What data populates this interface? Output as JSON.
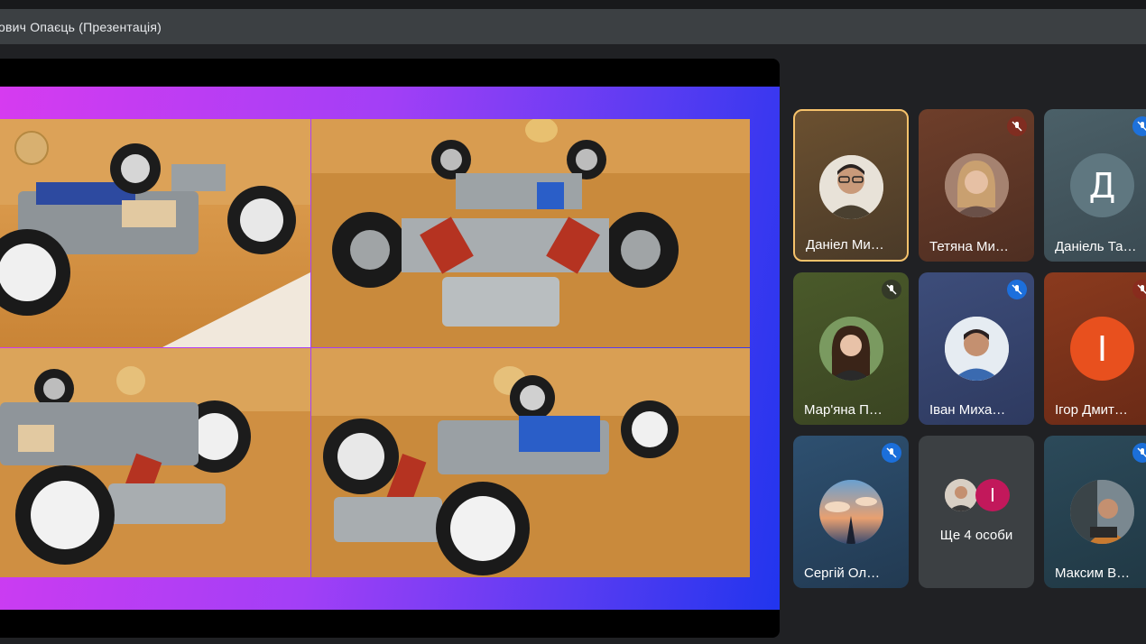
{
  "title": "ович Опаєць (Презентація)",
  "colors": {
    "background": "#202124",
    "titlebar": "#3c4043",
    "speaking_border": "#f6c26b",
    "mic_badge": "#1a73e8"
  },
  "presentation": {
    "slide_images": [
      "car-photo-top-left",
      "car-photo-top-right",
      "car-photo-bottom-left",
      "car-photo-bottom-right"
    ]
  },
  "participants": [
    {
      "name": "Даніел Ми…",
      "avatar": "photo",
      "speaking": true,
      "muted": false
    },
    {
      "name": "Тетяна Ми…",
      "avatar": "photo",
      "speaking": false,
      "muted": true
    },
    {
      "name": "Даніель Та…",
      "avatar_letter": "Д",
      "speaking": false,
      "muted": true
    },
    {
      "name": "Мар'яна П…",
      "avatar": "photo",
      "speaking": false,
      "muted": true
    },
    {
      "name": "Іван Миха…",
      "avatar": "photo",
      "speaking": false,
      "muted": true
    },
    {
      "name": "Ігор Дмит…",
      "avatar_letter": "І",
      "speaking": false,
      "muted": true
    },
    {
      "name": "Сергій Ол…",
      "avatar": "photo",
      "speaking": false,
      "muted": true
    },
    {
      "name": "Ще 4 особи",
      "avatar_letter": "І",
      "group": true
    },
    {
      "name": "Максим В…",
      "avatar": "photo",
      "speaking": false,
      "muted": true
    }
  ]
}
